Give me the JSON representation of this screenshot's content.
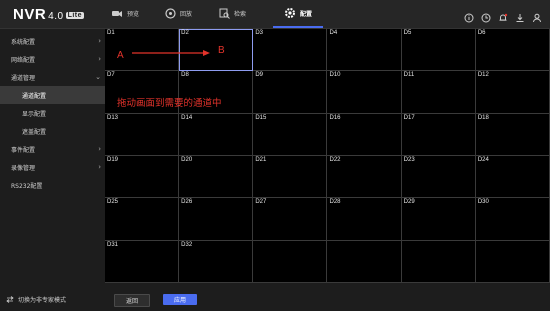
{
  "app": {
    "name": "NVR",
    "version": "4.0",
    "edition": "Lite"
  },
  "nav": [
    {
      "label": "预览",
      "icon": "camera-icon"
    },
    {
      "label": "回放",
      "icon": "playback-icon"
    },
    {
      "label": "检索",
      "icon": "search-doc-icon"
    },
    {
      "label": "配置",
      "icon": "gear-icon",
      "active": true
    }
  ],
  "sidebar": {
    "items": [
      {
        "label": "系统配置",
        "chevron": "›"
      },
      {
        "label": "网络配置",
        "chevron": "›"
      },
      {
        "label": "通道管理",
        "chevron": "⌄"
      },
      {
        "label": "通道配置",
        "sub": true,
        "active": true
      },
      {
        "label": "显示配置",
        "sub": true
      },
      {
        "label": "遮盖配置",
        "sub": true
      },
      {
        "label": "事件配置",
        "chevron": "›"
      },
      {
        "label": "录像管理",
        "chevron": "›"
      },
      {
        "label": "RS232配置"
      }
    ],
    "footer_label": "切换为非专家模式"
  },
  "channels": [
    "D1",
    "D2",
    "D3",
    "D4",
    "D5",
    "D6",
    "D7",
    "D8",
    "D9",
    "D10",
    "D11",
    "D12",
    "D13",
    "D14",
    "D15",
    "D16",
    "D17",
    "D18",
    "D19",
    "D20",
    "D21",
    "D22",
    "D23",
    "D24",
    "D25",
    "D26",
    "D27",
    "D28",
    "D29",
    "D30",
    "D31",
    "D32",
    "",
    "",
    "",
    ""
  ],
  "buttons": {
    "back_label": "返回",
    "apply_label": "应用"
  },
  "annotation": {
    "a": "A",
    "b": "B",
    "instruction": "拖动画面到需要的通道中",
    "color": "#e4332b"
  },
  "colors": {
    "accent": "#4a6cf0"
  }
}
